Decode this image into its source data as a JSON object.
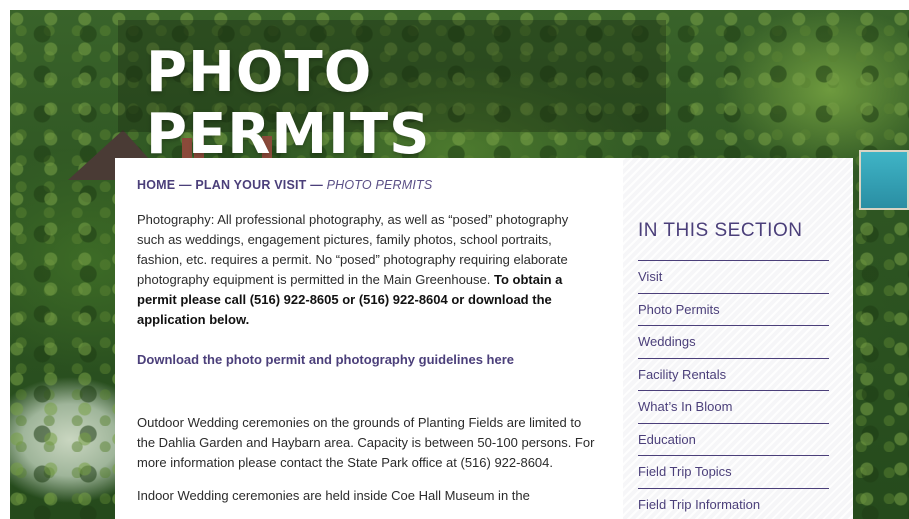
{
  "hero": {
    "title": "PHOTO PERMITS"
  },
  "breadcrumb": {
    "home": "HOME",
    "separator": "—",
    "plan": "PLAN YOUR VISIT",
    "current": "PHOTO PERMITS"
  },
  "content": {
    "intro_text": "Photography: All professional photography, as well as “posed” photography such as weddings, engagement pictures, family photos, school portraits, fashion, etc. requires a permit. No “posed” photography requiring elaborate photography equipment is permitted in the Main Greenhouse.",
    "intro_bold": "To  obtain a permit please call (516) 922-8605 or (516) 922-8604 or download the application below.",
    "download_link": "Download the photo permit and photography guidelines here",
    "outdoor_text": "Outdoor Wedding ceremonies on the grounds of Planting Fields are limited to the Dahlia Garden and Haybarn area. Capacity is between 50-100 persons. For more information please contact the State Park office at (516) 922-8604.",
    "indoor_text": "Indoor Wedding ceremonies are held inside Coe Hall Museum in the"
  },
  "sidebar": {
    "heading": "IN THIS SECTION",
    "items": [
      {
        "label": "Visit"
      },
      {
        "label": "Photo Permits"
      },
      {
        "label": "Weddings"
      },
      {
        "label": "Facility Rentals"
      },
      {
        "label": "What’s In Bloom"
      },
      {
        "label": "Education"
      },
      {
        "label": "Field Trip Topics"
      },
      {
        "label": "Field Trip Information"
      }
    ]
  },
  "colors": {
    "accent": "#4b3f7a",
    "text": "#2b2b2b",
    "hero_green": "#2e5522"
  }
}
